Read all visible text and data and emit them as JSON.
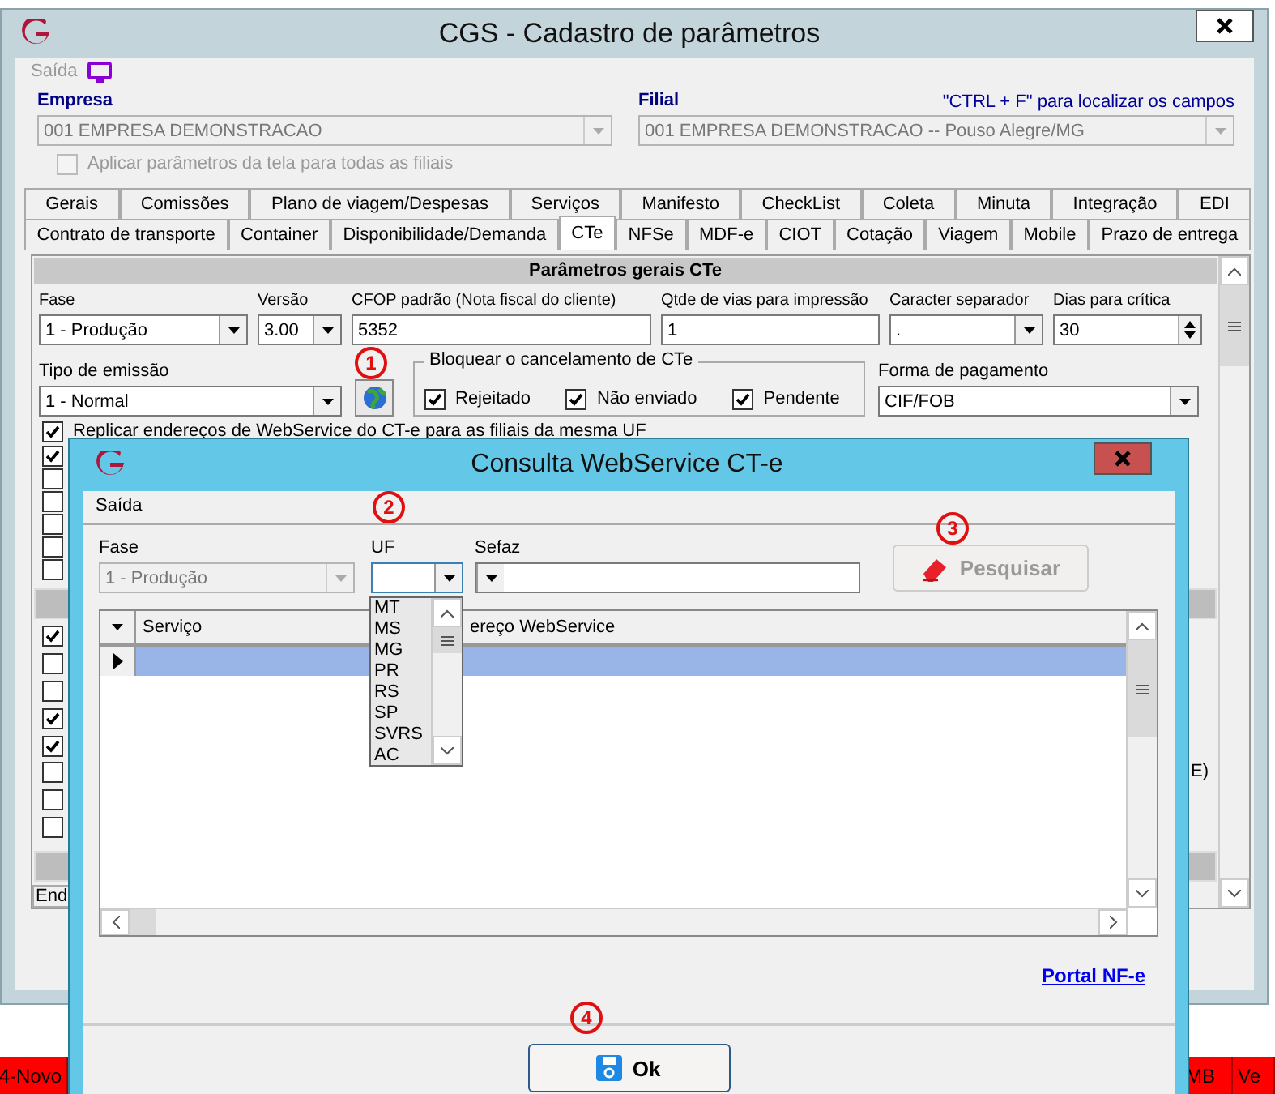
{
  "main_window": {
    "title": "CGS - Cadastro de parâmetros",
    "menu": "Saída",
    "empresa": {
      "label": "Empresa",
      "value": "001 EMPRESA DEMONSTRACAO",
      "disabled": true
    },
    "filial": {
      "label": "Filial",
      "value": "001 EMPRESA DEMONSTRACAO -- Pouso Alegre/MG",
      "disabled": true
    },
    "hint": "\"CTRL + F\" para localizar os campos",
    "apply_all": {
      "label": "Aplicar parâmetros da tela para todas as filiais",
      "checked": false,
      "disabled": true
    },
    "tab_rows": [
      [
        {
          "label": "Gerais",
          "selected": false
        },
        {
          "label": "Comissões",
          "selected": false
        },
        {
          "label": "Plano de viagem/Despesas",
          "selected": false
        },
        {
          "label": "Serviços",
          "selected": false
        },
        {
          "label": "Manifesto",
          "selected": false
        },
        {
          "label": "CheckList",
          "selected": false
        },
        {
          "label": "Coleta",
          "selected": false
        },
        {
          "label": "Minuta",
          "selected": false
        },
        {
          "label": "Integração",
          "selected": false
        },
        {
          "label": "EDI",
          "selected": false
        }
      ],
      [
        {
          "label": "Contrato de transporte",
          "selected": false
        },
        {
          "label": "Container",
          "selected": false
        },
        {
          "label": "Disponibilidade/Demanda",
          "selected": false
        },
        {
          "label": "CTe",
          "selected": true
        },
        {
          "label": "NFSe",
          "selected": false
        },
        {
          "label": "MDF-e",
          "selected": false
        },
        {
          "label": "CIOT",
          "selected": false
        },
        {
          "label": "Cotação",
          "selected": false
        },
        {
          "label": "Viagem",
          "selected": false
        },
        {
          "label": "Mobile",
          "selected": false
        },
        {
          "label": "Prazo de entrega",
          "selected": false
        }
      ]
    ],
    "panel": {
      "title": "Parâmetros gerais CTe",
      "fields": [
        {
          "label": "Fase",
          "value": "1 - Produção",
          "kind": "combo"
        },
        {
          "label": "Versão",
          "value": "3.00",
          "kind": "combo"
        },
        {
          "label": "CFOP padrão (Nota fiscal do cliente)",
          "value": "5352",
          "kind": "text"
        },
        {
          "label": "Qtde de vias para impressão",
          "value": "1",
          "kind": "text"
        },
        {
          "label": "Caracter separador",
          "value": ".",
          "kind": "combo"
        },
        {
          "label": "Dias para crítica",
          "value": "30",
          "kind": "spin"
        }
      ],
      "tipo_emissao": {
        "label": "Tipo de emissão",
        "value": "1 - Normal"
      },
      "bloquear": {
        "title": "Bloquear o cancelamento de CTe",
        "options": [
          {
            "label": "Rejeitado",
            "checked": true
          },
          {
            "label": "Não enviado",
            "checked": true
          },
          {
            "label": "Pendente",
            "checked": true
          }
        ]
      },
      "forma_pagamento": {
        "label": "Forma de pagamento",
        "value": "CIF/FOB"
      },
      "replicar": {
        "label": "Replicar endereços de WebService do CT-e para as filiais da mesma UF",
        "checked": true
      },
      "checklist_a": [
        {
          "checked": true
        },
        {
          "checked": false
        },
        {
          "checked": false
        },
        {
          "checked": false
        },
        {
          "checked": false
        },
        {
          "checked": false
        }
      ],
      "checklist_b": [
        {
          "checked": true
        },
        {
          "checked": false
        },
        {
          "checked": false
        },
        {
          "checked": true
        },
        {
          "checked": true
        },
        {
          "checked": false,
          "text": "E)"
        },
        {
          "checked": false
        },
        {
          "checked": false
        }
      ],
      "column_1": "End"
    }
  },
  "status_bar": [
    "4-Novo",
    "MB",
    "Ve"
  ],
  "dialog": {
    "title": "Consulta WebService CT-e",
    "menu": "Saída",
    "fase": {
      "label": "Fase",
      "value": "1 - Produção",
      "disabled": true
    },
    "uf": {
      "label": "UF",
      "expanded": true,
      "options": [
        "MT",
        "MS",
        "MG",
        "PR",
        "RS",
        "SP",
        "SVRS",
        "AC"
      ]
    },
    "sefaz": {
      "label": "Sefaz"
    },
    "search_button": {
      "label": "Pesquisar",
      "disabled": true
    },
    "table": {
      "columns": [
        "Serviço",
        "ereço WebService"
      ],
      "rows": [
        {
          "selected": true
        }
      ]
    },
    "link": "Portal NF-e",
    "ok_button": "Ok"
  },
  "annotations": [
    "1",
    "2",
    "3",
    "4"
  ]
}
